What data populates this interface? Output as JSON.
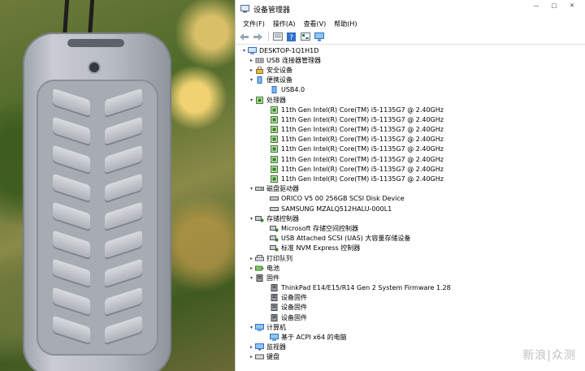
{
  "window": {
    "title": "设备管理器",
    "menu": [
      "文件(F)",
      "操作(A)",
      "查看(V)",
      "帮助(H)"
    ],
    "controls": [
      "—",
      "□",
      "✕"
    ]
  },
  "toolbar": {
    "icons": [
      "back-arrow-icon",
      "forward-arrow-icon",
      "properties-icon",
      "help-icon",
      "update-driver-icon",
      "monitor-icon"
    ]
  },
  "tree": {
    "root": "DESKTOP-1Q1H1D",
    "usb_connector": "USB 连接器管理器",
    "security": "安全设备",
    "portable": "便携设备",
    "portable_usb": "USB4.0",
    "processors": "处理器",
    "cpu": [
      "11th Gen Intel(R) Core(TM) i5-1135G7 @ 2.40GHz",
      "11th Gen Intel(R) Core(TM) i5-1135G7 @ 2.40GHz",
      "11th Gen Intel(R) Core(TM) i5-1135G7 @ 2.40GHz",
      "11th Gen Intel(R) Core(TM) i5-1135G7 @ 2.40GHz",
      "11th Gen Intel(R) Core(TM) i5-1135G7 @ 2.40GHz",
      "11th Gen Intel(R) Core(TM) i5-1135G7 @ 2.40GHz",
      "11th Gen Intel(R) Core(TM) i5-1135G7 @ 2.40GHz",
      "11th Gen Intel(R) Core(TM) i5-1135G7 @ 2.40GHz"
    ],
    "disk_drives": "磁盘驱动器",
    "disks": [
      "ORICO V5 00 256GB SCSI Disk Device",
      "SAMSUNG MZALQ512HALU-000L1"
    ],
    "storage_controllers": "存储控制器",
    "storage": [
      "Microsoft 存储空间控制器",
      "USB Attached SCSI (UAS) 大容量存储设备",
      "标准 NVM Express 控制器"
    ],
    "print_queue": "打印队列",
    "battery": "电池",
    "firmware": "固件",
    "firmware_items": [
      "ThinkPad E14/E15/R14 Gen 2 System Firmware 1.28",
      "设备固件",
      "设备固件",
      "设备固件"
    ],
    "computer": "计算机",
    "computer_item": "基于 ACPI x64 的电脑",
    "monitors": "监视器",
    "keyboard": "键盘"
  },
  "watermark": "新浪|众测",
  "colors": {
    "accent": "#2f6fc9",
    "cpu_icon": "#3d7a2d"
  }
}
